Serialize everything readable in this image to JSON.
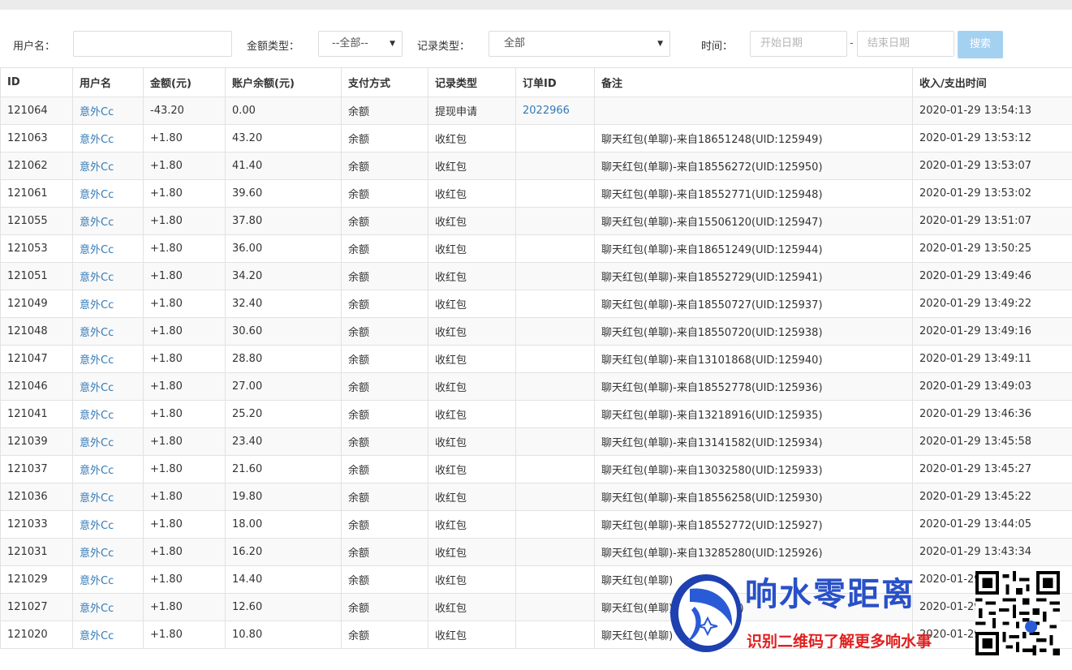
{
  "filters": {
    "username_label": "用户名：",
    "username_value": "",
    "amount_type_label": "金额类型：",
    "amount_type_value": "--全部--",
    "record_type_label": "记录类型：",
    "record_type_value": "全部",
    "time_label": "时间：",
    "start_date_placeholder": "开始日期",
    "date_separator": "-",
    "end_date_placeholder": "结束日期",
    "search_label": "搜索"
  },
  "table": {
    "headers": [
      "ID",
      "用户名",
      "金额(元)",
      "账户余额(元)",
      "支付方式",
      "记录类型",
      "订单ID",
      "备注",
      "收入/支出时间"
    ],
    "rows": [
      [
        "121064",
        "意外Cc",
        "-43.20",
        "0.00",
        "余额",
        "提现申请",
        "2022966",
        "",
        "2020-01-29 13:54:13"
      ],
      [
        "121063",
        "意外Cc",
        "+1.80",
        "43.20",
        "余额",
        "收红包",
        "",
        "聊天红包(单聊)-来自18651248(UID:125949)",
        "2020-01-29 13:53:12"
      ],
      [
        "121062",
        "意外Cc",
        "+1.80",
        "41.40",
        "余额",
        "收红包",
        "",
        "聊天红包(单聊)-来自18556272(UID:125950)",
        "2020-01-29 13:53:07"
      ],
      [
        "121061",
        "意外Cc",
        "+1.80",
        "39.60",
        "余额",
        "收红包",
        "",
        "聊天红包(单聊)-来自18552771(UID:125948)",
        "2020-01-29 13:53:02"
      ],
      [
        "121055",
        "意外Cc",
        "+1.80",
        "37.80",
        "余额",
        "收红包",
        "",
        "聊天红包(单聊)-来自15506120(UID:125947)",
        "2020-01-29 13:51:07"
      ],
      [
        "121053",
        "意外Cc",
        "+1.80",
        "36.00",
        "余额",
        "收红包",
        "",
        "聊天红包(单聊)-来自18651249(UID:125944)",
        "2020-01-29 13:50:25"
      ],
      [
        "121051",
        "意外Cc",
        "+1.80",
        "34.20",
        "余额",
        "收红包",
        "",
        "聊天红包(单聊)-来自18552729(UID:125941)",
        "2020-01-29 13:49:46"
      ],
      [
        "121049",
        "意外Cc",
        "+1.80",
        "32.40",
        "余额",
        "收红包",
        "",
        "聊天红包(单聊)-来自18550727(UID:125937)",
        "2020-01-29 13:49:22"
      ],
      [
        "121048",
        "意外Cc",
        "+1.80",
        "30.60",
        "余额",
        "收红包",
        "",
        "聊天红包(单聊)-来自18550720(UID:125938)",
        "2020-01-29 13:49:16"
      ],
      [
        "121047",
        "意外Cc",
        "+1.80",
        "28.80",
        "余额",
        "收红包",
        "",
        "聊天红包(单聊)-来自13101868(UID:125940)",
        "2020-01-29 13:49:11"
      ],
      [
        "121046",
        "意外Cc",
        "+1.80",
        "27.00",
        "余额",
        "收红包",
        "",
        "聊天红包(单聊)-来自18552778(UID:125936)",
        "2020-01-29 13:49:03"
      ],
      [
        "121041",
        "意外Cc",
        "+1.80",
        "25.20",
        "余额",
        "收红包",
        "",
        "聊天红包(单聊)-来自13218916(UID:125935)",
        "2020-01-29 13:46:36"
      ],
      [
        "121039",
        "意外Cc",
        "+1.80",
        "23.40",
        "余额",
        "收红包",
        "",
        "聊天红包(单聊)-来自13141582(UID:125934)",
        "2020-01-29 13:45:58"
      ],
      [
        "121037",
        "意外Cc",
        "+1.80",
        "21.60",
        "余额",
        "收红包",
        "",
        "聊天红包(单聊)-来自13032580(UID:125933)",
        "2020-01-29 13:45:27"
      ],
      [
        "121036",
        "意外Cc",
        "+1.80",
        "19.80",
        "余额",
        "收红包",
        "",
        "聊天红包(单聊)-来自18556258(UID:125930)",
        "2020-01-29 13:45:22"
      ],
      [
        "121033",
        "意外Cc",
        "+1.80",
        "18.00",
        "余额",
        "收红包",
        "",
        "聊天红包(单聊)-来自18552772(UID:125927)",
        "2020-01-29 13:44:05"
      ],
      [
        "121031",
        "意外Cc",
        "+1.80",
        "16.20",
        "余额",
        "收红包",
        "",
        "聊天红包(单聊)-来自13285280(UID:125926)",
        "2020-01-29 13:43:34"
      ],
      [
        "121029",
        "意外Cc",
        "+1.80",
        "14.40",
        "余额",
        "收红包",
        "",
        "聊天红包(单聊)",
        "2020-01-29"
      ],
      [
        "121027",
        "意外Cc",
        "+1.80",
        "12.60",
        "余额",
        "收红包",
        "",
        "聊天红包(单聊)(UID:125914)",
        "2020-01-29"
      ],
      [
        "121020",
        "意外Cc",
        "+1.80",
        "10.80",
        "余额",
        "收红包",
        "",
        "聊天红包(单聊)",
        "2020-01-29"
      ]
    ]
  },
  "watermark": {
    "title": "响水零距离",
    "subtitle": "识别二维码了解更多响水事"
  }
}
